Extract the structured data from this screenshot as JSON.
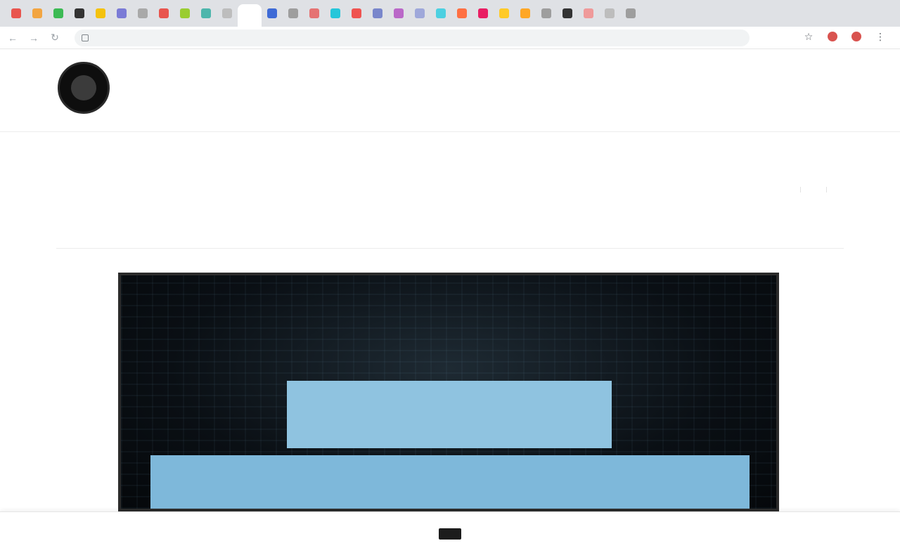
{
  "browser": {
    "tab_favicon_colors": [
      "#e8554e",
      "#f2a541",
      "#3cba54",
      "#333333",
      "#f4c20d",
      "#7b7bd6",
      "#a9a9a9",
      "#e8554e",
      "#9acd32",
      "#4db6ac",
      "#bdbdbd",
      "#ffffff",
      "#3f6bd6",
      "#9e9e9e",
      "#e57373",
      "#26c6da",
      "#ef5350",
      "#7986cb",
      "#ba68c8",
      "#9fa8da",
      "#4dd0e1",
      "#ff7043",
      "#e91e63",
      "#ffca28",
      "#ffa726",
      "#9e9e9e",
      "#333333",
      "#ef9a9a",
      "#bdbdbd",
      "#9e9e9e"
    ],
    "active_tab_index": 11,
    "address": {
      "url": "",
      "lock_icon": "lock-icon"
    },
    "toolbar_icons": [
      "star-icon",
      "extension-icon",
      "profile-icon",
      "menu-icon"
    ]
  },
  "site": {
    "logo": "site-logo",
    "nav": [
      "",
      "",
      "",
      ""
    ]
  },
  "article": {
    "title": "",
    "meta": [
      "",
      "",
      ""
    ],
    "tools": [
      "",
      "",
      ""
    ]
  },
  "hero": {
    "line1": "",
    "line2": "",
    "colors": {
      "panel": "#8fc3e0",
      "text": "#0d3a55",
      "bg": "#0a0f14"
    }
  },
  "cookie": {
    "text": "",
    "accept_label": "",
    "link_label": ""
  }
}
